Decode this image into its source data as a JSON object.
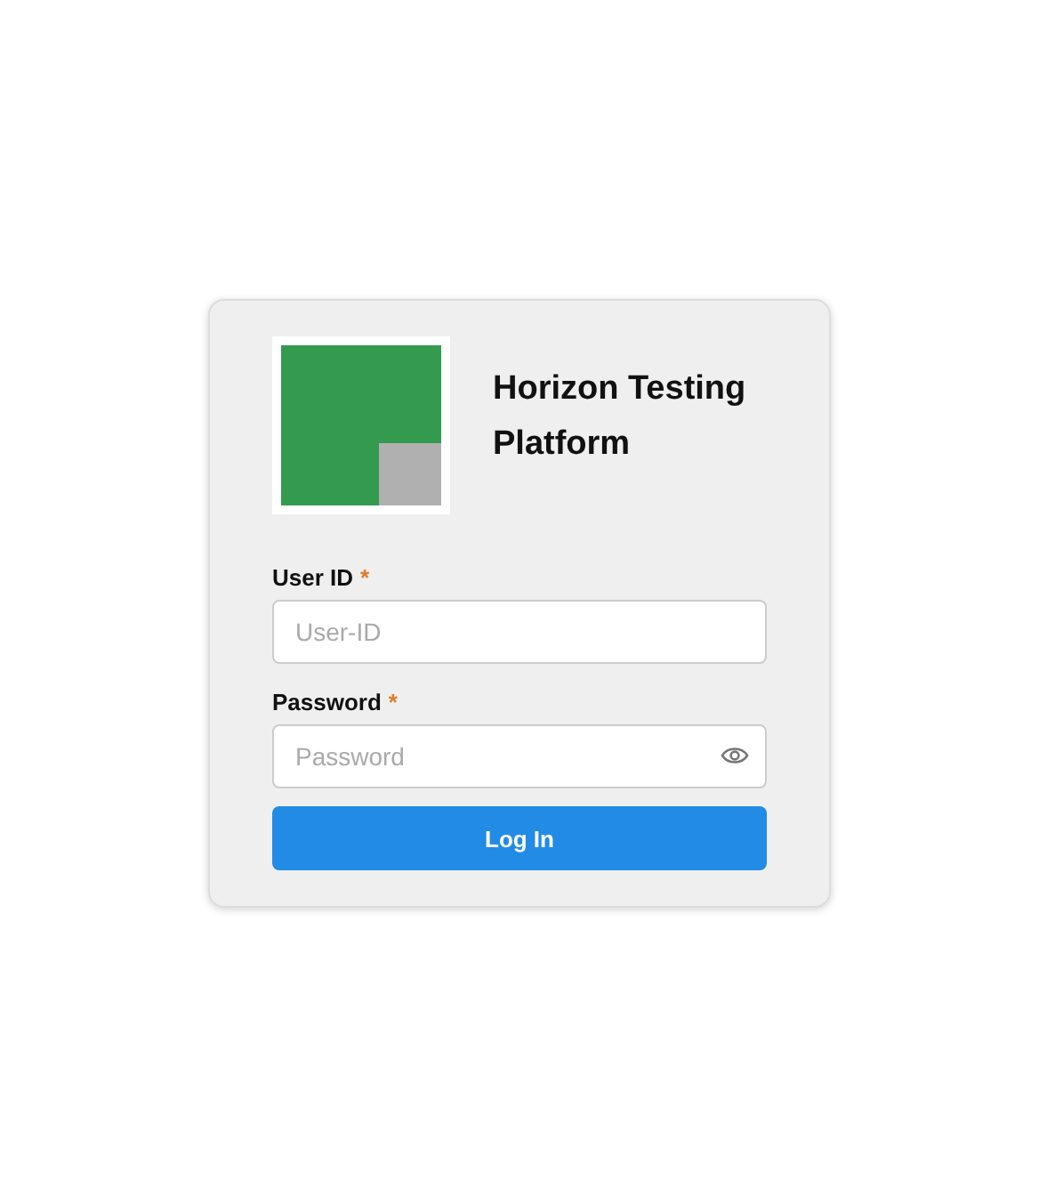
{
  "app": {
    "title": "Horizon Testing Platform"
  },
  "fields": [
    {
      "kind": "text",
      "label": "User ID",
      "required_mark": "*",
      "placeholder": "User-ID"
    },
    {
      "kind": "password",
      "label": "Password",
      "required_mark": "*",
      "placeholder": "Password"
    }
  ],
  "submit_button": "Log In"
}
